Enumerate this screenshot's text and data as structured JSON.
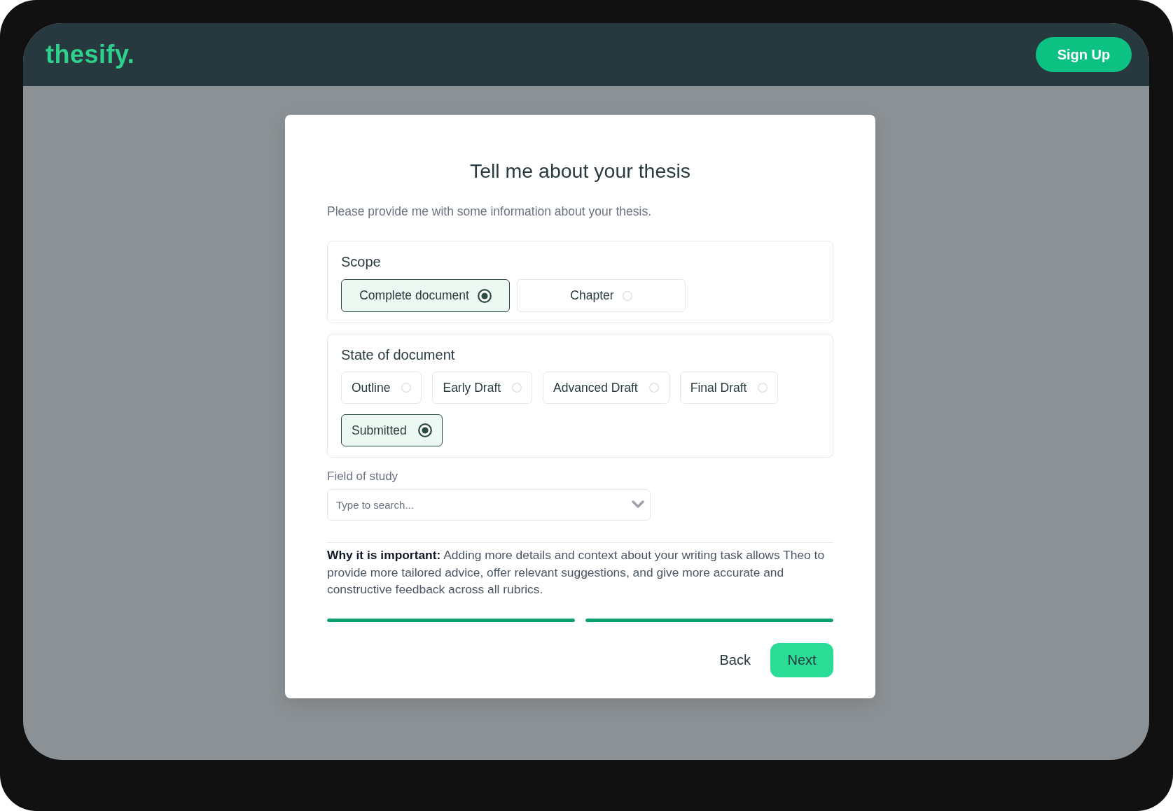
{
  "header": {
    "logo": "thesify.",
    "sign_up": "Sign Up"
  },
  "dialog": {
    "title": "Tell me about your thesis",
    "subtitle": "Please provide me with some information about your thesis.",
    "groups": [
      {
        "label": "Scope",
        "kind": "wide",
        "options": [
          {
            "label": "Complete document",
            "selected": true
          },
          {
            "label": "Chapter",
            "selected": false
          }
        ]
      },
      {
        "label": "State of document",
        "kind": "compact",
        "options": [
          {
            "label": "Outline",
            "selected": false
          },
          {
            "label": "Early Draft",
            "selected": false
          },
          {
            "label": "Advanced Draft",
            "selected": false
          },
          {
            "label": "Final Draft",
            "selected": false
          },
          {
            "label": "Submitted",
            "selected": true
          }
        ]
      }
    ],
    "field_of_study": {
      "label": "Field of study",
      "placeholder": "Type to search..."
    },
    "note": "**Why it is important:** Adding more details and context about your writing task allows Theo to provide more tailored advice, offer relevant suggestions, and give more accurate and constructive feedback across all rubrics.",
    "progress": [
      {
        "level": 1
      },
      {
        "level": 1
      }
    ],
    "buttons": [
      {
        "label": "Back",
        "kind": "text"
      },
      {
        "label": "Next",
        "kind": "primary"
      }
    ]
  }
}
